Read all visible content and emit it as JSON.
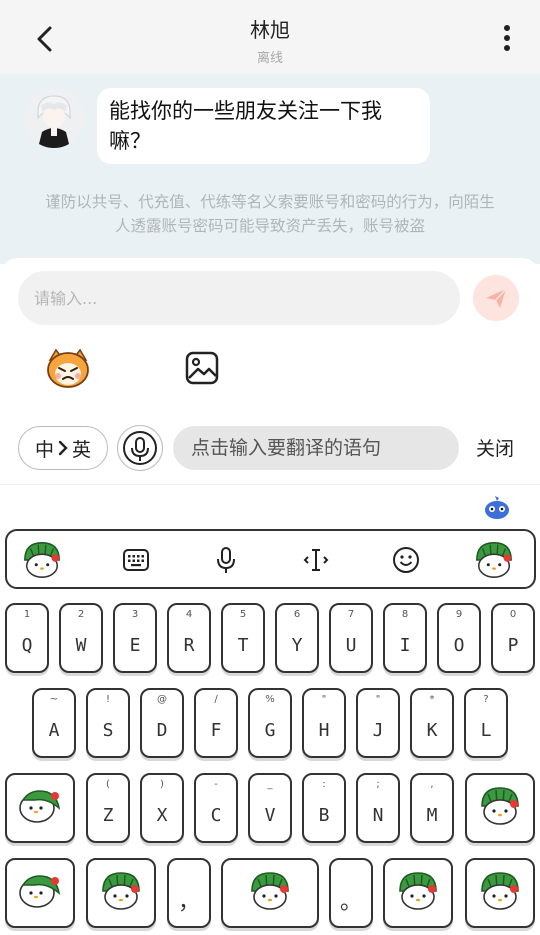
{
  "header": {
    "title": "林旭",
    "status": "离线"
  },
  "chat": {
    "message": "能找你的一些朋友关注一下我嘛？",
    "warning": "谨防以共号、代充值、代练等名义索要账号和密码的行为，向陌生人透露账号密码可能导致资产丢失，账号被盗"
  },
  "composer": {
    "placeholder": "请输入..."
  },
  "translate": {
    "from": "中",
    "to": "英",
    "placeholder": "点击输入要翻译的语句",
    "close_label": "关闭"
  },
  "keyboard": {
    "toolbar_icons": [
      "watermelon-mascot-icon",
      "keyboard-icon",
      "microphone-icon",
      "cursor-icon",
      "smiley-icon",
      "watermelon-mascot-icon"
    ],
    "row1": [
      {
        "label": "Q",
        "hint": "1"
      },
      {
        "label": "W",
        "hint": "2"
      },
      {
        "label": "E",
        "hint": "3"
      },
      {
        "label": "R",
        "hint": "4"
      },
      {
        "label": "T",
        "hint": "5"
      },
      {
        "label": "Y",
        "hint": "6"
      },
      {
        "label": "U",
        "hint": "7"
      },
      {
        "label": "I",
        "hint": "8"
      },
      {
        "label": "O",
        "hint": "9"
      },
      {
        "label": "P",
        "hint": "0"
      }
    ],
    "row2": [
      {
        "label": "A",
        "hint": "~"
      },
      {
        "label": "S",
        "hint": "!"
      },
      {
        "label": "D",
        "hint": "@"
      },
      {
        "label": "F",
        "hint": "/"
      },
      {
        "label": "G",
        "hint": "%"
      },
      {
        "label": "H",
        "hint": "\""
      },
      {
        "label": "J",
        "hint": "\""
      },
      {
        "label": "K",
        "hint": "*"
      },
      {
        "label": "L",
        "hint": "?"
      }
    ],
    "row3": [
      {
        "label": "Z",
        "hint": "("
      },
      {
        "label": "X",
        "hint": ")"
      },
      {
        "label": "C",
        "hint": "-"
      },
      {
        "label": "V",
        "hint": "_"
      },
      {
        "label": "B",
        "hint": ":"
      },
      {
        "label": "N",
        "hint": ";"
      },
      {
        "label": "M",
        "hint": ","
      }
    ],
    "row4": {
      "comma": "，",
      "period": "。"
    }
  }
}
